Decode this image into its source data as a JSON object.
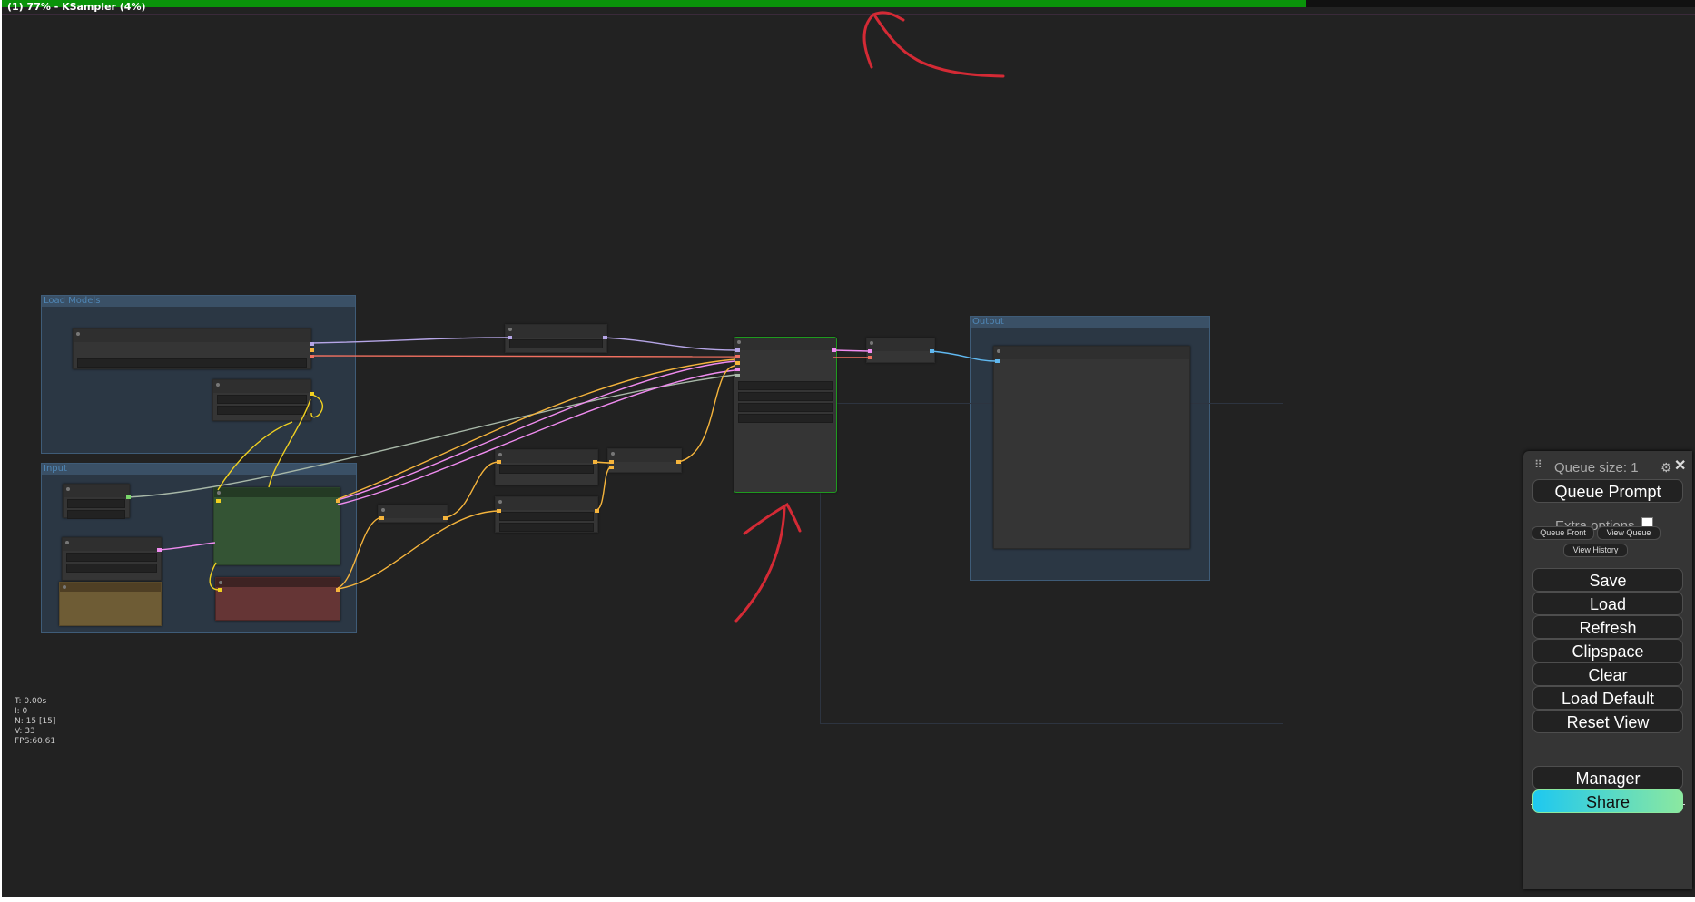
{
  "progress": {
    "label": "(1) 77% - KSampler (4%)",
    "fraction": 0.77,
    "color": "#0a930a"
  },
  "groups": {
    "load_models": "Load Models",
    "input": "Input",
    "output": "Output"
  },
  "stats": {
    "time": "T: 0.00s",
    "i": "I: 0",
    "n": "N: 15 [15]",
    "v": "V: 33",
    "fps": "FPS:60.61"
  },
  "menu": {
    "drag_icon": "drag-handle-icon",
    "queue_size": "Queue size: 1",
    "queue_prompt": "Queue Prompt",
    "extra_options": "Extra options",
    "queue_front": "Queue Front",
    "view_queue": "View Queue",
    "view_history": "View History",
    "save": "Save",
    "load": "Load",
    "refresh": "Refresh",
    "clipspace": "Clipspace",
    "clear": "Clear",
    "load_default": "Load Default",
    "reset_view": "Reset View",
    "manager": "Manager",
    "share": "Share"
  },
  "colors": {
    "canvas": "#222222",
    "group": "#2b3744",
    "positive_prompt": "#345434",
    "negative_prompt": "#653535",
    "note": "#6e5c35",
    "annotation": "#d42a35"
  }
}
